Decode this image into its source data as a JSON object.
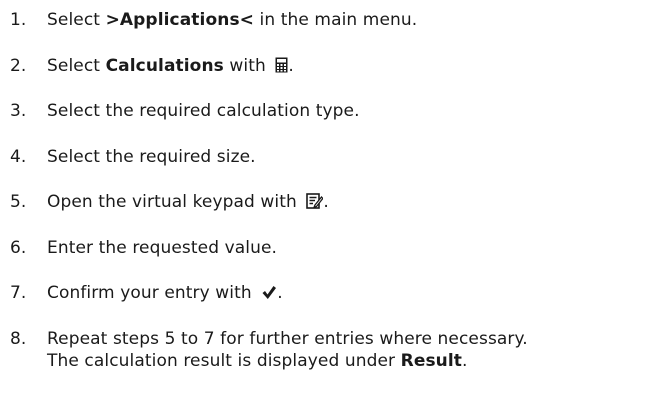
{
  "steps": [
    {
      "number": "1.",
      "before": "Select ",
      "bold": ">Applications<",
      "after": " in the main menu."
    },
    {
      "number": "2.",
      "before": "Select ",
      "bold": "Calculations",
      "after": " with",
      "end": ".",
      "icon": "calculator-icon"
    },
    {
      "number": "3.",
      "text": "Select the required calculation type."
    },
    {
      "number": "4.",
      "text": "Select the required size."
    },
    {
      "number": "5.",
      "before": "Open the virtual keypad with",
      "end": ".",
      "icon": "edit-keypad-icon"
    },
    {
      "number": "6.",
      "text": "Enter the requested value."
    },
    {
      "number": "7.",
      "before": "Confirm your entry with",
      "end": ".",
      "icon": "checkmark-icon"
    },
    {
      "number": "8.",
      "line1": "Repeat steps 5 to 7 for further entries where necessary.",
      "line2_before": "The calculation result is displayed under ",
      "line2_bold": "Result",
      "line2_end": "."
    }
  ]
}
